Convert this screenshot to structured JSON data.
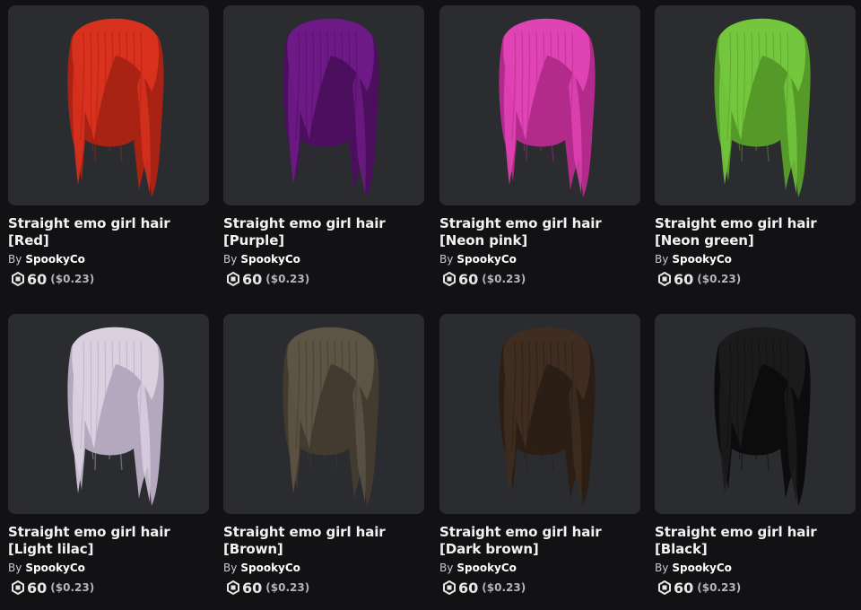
{
  "items": [
    {
      "title": "Straight emo girl hair [Red]",
      "by": "By",
      "creator": "SpookyCo",
      "price": "60",
      "usd": "($0.23)",
      "hair_color": "#d8311e",
      "hair_shade": "#a82313"
    },
    {
      "title": "Straight emo girl hair [Purple]",
      "by": "By",
      "creator": "SpookyCo",
      "price": "60",
      "usd": "($0.23)",
      "hair_color": "#6e1a86",
      "hair_shade": "#4b0f5e"
    },
    {
      "title": "Straight emo girl hair [Neon pink]",
      "by": "By",
      "creator": "SpookyCo",
      "price": "60",
      "usd": "($0.23)",
      "hair_color": "#e043b4",
      "hair_shade": "#b22a8a"
    },
    {
      "title": "Straight emo girl hair [Neon green]",
      "by": "By",
      "creator": "SpookyCo",
      "price": "60",
      "usd": "($0.23)",
      "hair_color": "#74c73d",
      "hair_shade": "#559a29"
    },
    {
      "title": "Straight emo girl hair [Light lilac]",
      "by": "By",
      "creator": "SpookyCo",
      "price": "60",
      "usd": "($0.23)",
      "hair_color": "#d9d0e0",
      "hair_shade": "#b3a8bd"
    },
    {
      "title": "Straight emo girl hair [Brown]",
      "by": "By",
      "creator": "SpookyCo",
      "price": "60",
      "usd": "($0.23)",
      "hair_color": "#5e5445",
      "hair_shade": "#433b30"
    },
    {
      "title": "Straight emo girl hair [Dark brown]",
      "by": "By",
      "creator": "SpookyCo",
      "price": "60",
      "usd": "($0.23)",
      "hair_color": "#3e2d20",
      "hair_shade": "#2a1e15"
    },
    {
      "title": "Straight emo girl hair [Black]",
      "by": "By",
      "creator": "SpookyCo",
      "price": "60",
      "usd": "($0.23)",
      "hair_color": "#1b1b1c",
      "hair_shade": "#0c0c0d"
    }
  ]
}
